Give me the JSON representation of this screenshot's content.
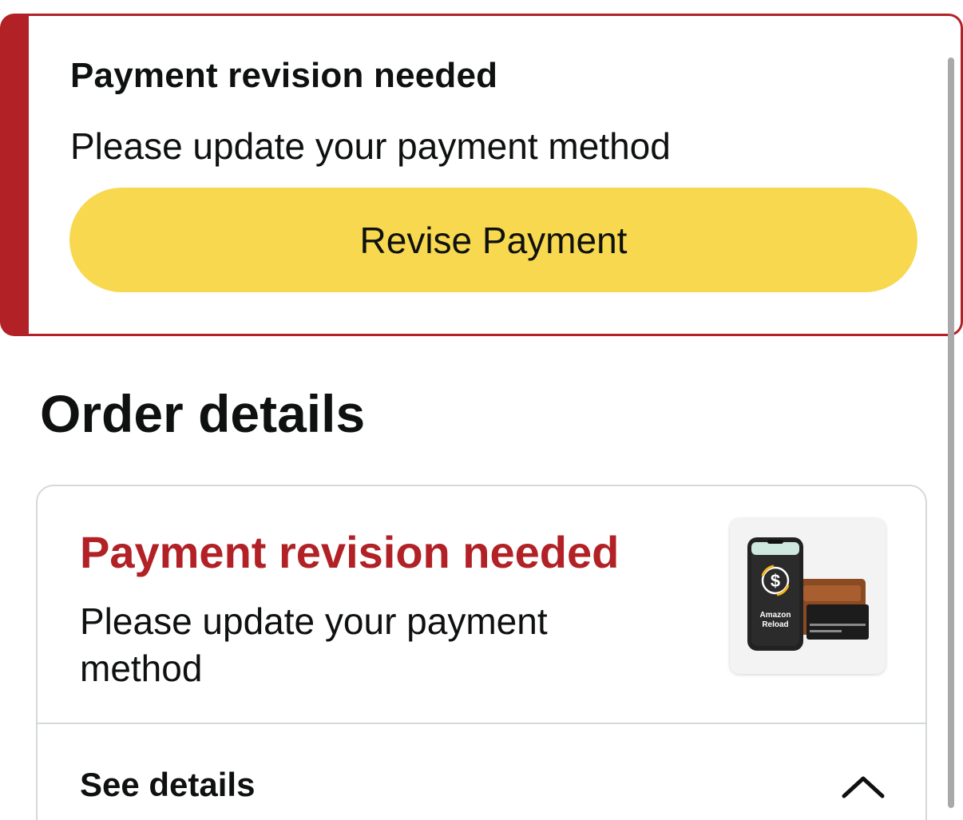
{
  "alert": {
    "title": "Payment revision needed",
    "message": "Please update your payment method",
    "button_label": "Revise Payment",
    "accent_color": "#b12126",
    "button_color": "#f7d84e"
  },
  "order": {
    "heading": "Order details",
    "status_title": "Payment revision needed",
    "status_message": "Please update your payment method",
    "status_color": "#b12126",
    "image": {
      "icon": "amazon-reload-phone-wallet-image",
      "lines": [
        "Amazon",
        "Reload"
      ]
    },
    "see_details_label": "See details",
    "see_details_icon": "chevron-up-icon"
  }
}
